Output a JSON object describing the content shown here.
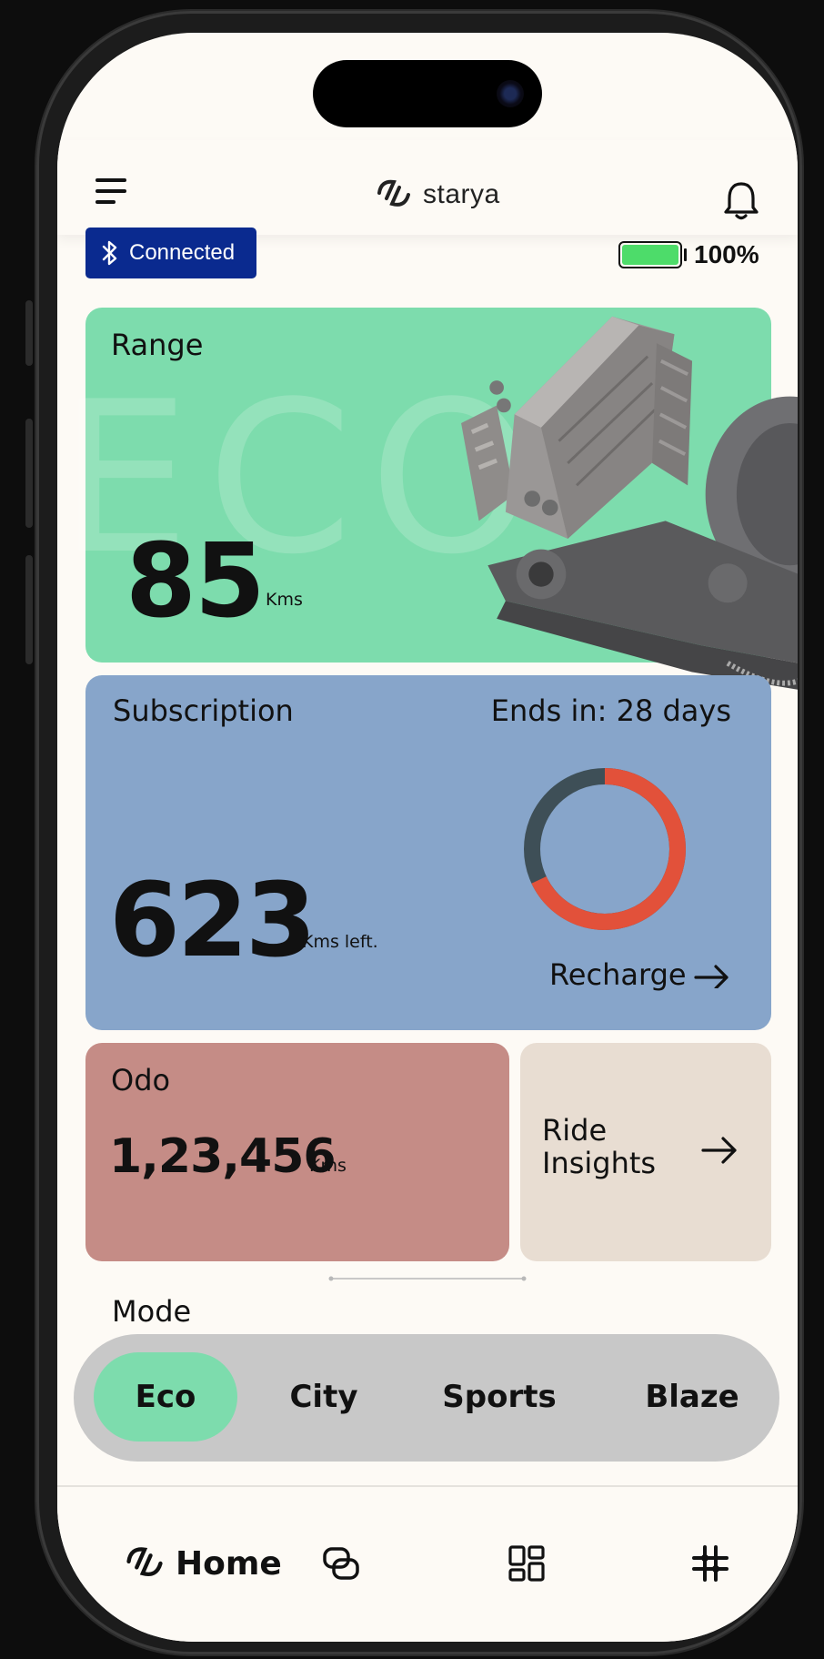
{
  "app": {
    "logo_text": "starya",
    "colors": {
      "accent_green": "#7ddcad",
      "subscription_blue": "#87a5ca",
      "odo_rose": "#c58c86",
      "insights_beige": "#e8ddd2",
      "bluetooth_badge": "#0a2a8f",
      "battery_green": "#4ddc6a",
      "donut_used": "#e2513a",
      "donut_remaining": "#3e4f57"
    }
  },
  "header": {
    "menu_icon": "hamburger-menu-icon",
    "notification_icon": "bell-icon"
  },
  "status": {
    "bluetooth_label": "Connected",
    "battery_level": 1.0,
    "battery_text": "100%"
  },
  "range": {
    "title": "Range",
    "mode_watermark": "ECO",
    "value": "85",
    "unit": "Kms"
  },
  "subscription": {
    "title": "Subscription",
    "ends_text": "Ends in: 28 days",
    "value": "623",
    "unit": "Kms left.",
    "progress_fraction": 0.68,
    "recharge_label": "Recharge"
  },
  "odo": {
    "title": "Odo",
    "value": "1,23,456",
    "unit": "Kms"
  },
  "insights": {
    "label": "Ride Insights"
  },
  "mode": {
    "title": "Mode",
    "options": [
      "Eco",
      "City",
      "Sports",
      "Blaze"
    ],
    "selected": "Eco"
  },
  "nav": {
    "home_label": "Home",
    "icons": [
      "starya-logo-icon",
      "link-icon",
      "grid-icon",
      "scooter-icon"
    ]
  }
}
